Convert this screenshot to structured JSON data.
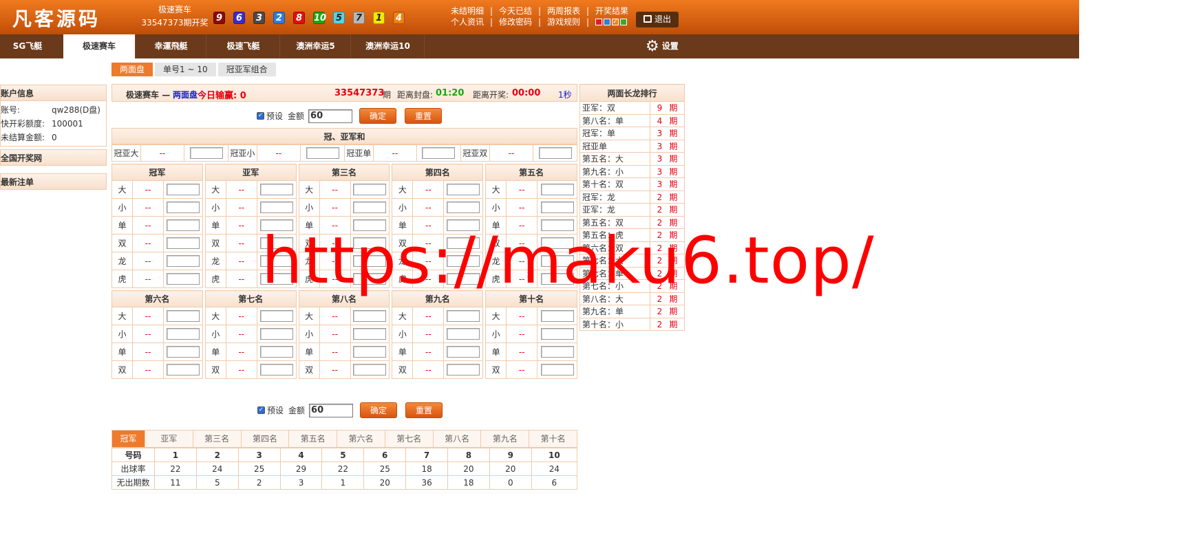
{
  "header": {
    "logo": "凡客源码",
    "game_name": "极速赛车",
    "period_text": "33547373期开奖",
    "balls": [
      {
        "n": "9",
        "color": "#8b0a0a"
      },
      {
        "n": "6",
        "color": "#3a2bd6"
      },
      {
        "n": "3",
        "color": "#4a4a4a"
      },
      {
        "n": "2",
        "color": "#2a7de0"
      },
      {
        "n": "8",
        "color": "#e01010"
      },
      {
        "n": "10",
        "color": "#17a812"
      },
      {
        "n": "5",
        "color": "#4fd5e5"
      },
      {
        "n": "7",
        "color": "#b7b7b7"
      },
      {
        "n": "1",
        "color": "#f5e800"
      },
      {
        "n": "4",
        "color": "#f07e10"
      }
    ],
    "links_row1": [
      "未结明细",
      "今天已结",
      "两周报表",
      "开奖结果"
    ],
    "links_row2": [
      "个人资讯",
      "修改密码",
      "游戏规则"
    ],
    "sep": "|",
    "swatches": [
      "#e02020",
      "#3a7ad8",
      "#f08020",
      "#3aa82a"
    ],
    "logout": "退出"
  },
  "nav": {
    "tabs": [
      "SG飞艇",
      "极速赛车",
      "幸運飛艇",
      "极速飞艇",
      "澳洲幸运5",
      "澳洲幸运10"
    ],
    "active": "极速赛车",
    "settings": "设置"
  },
  "subtabs": [
    "两面盘",
    "单号1 ~ 10",
    "冠亚军组合"
  ],
  "sidebar": {
    "account_title": "账户信息",
    "account_rows": [
      {
        "k": "账号:",
        "v": "qw288(D盘)"
      },
      {
        "k": "快开彩额度:",
        "v": "100001"
      },
      {
        "k": "未结算金额:",
        "v": "0"
      }
    ],
    "section2": "全国开奖网",
    "section3": "最新注单"
  },
  "status": {
    "game": "极速赛车",
    "dash": "—",
    "mode": "两面盘",
    "today_label": "今日输赢:",
    "today_value": "0",
    "period": "33547373",
    "period_suffix": "期",
    "close_label": "距离封盘:",
    "close_time": "01:20",
    "draw_label": "距离开奖:",
    "draw_time": "00:00",
    "refresh": "1秒"
  },
  "preset": {
    "label": "预设",
    "amount_label": "金额",
    "amount": "60",
    "confirm": "确定",
    "reset": "重置"
  },
  "guanya": {
    "title": "冠、亚军和",
    "items": [
      {
        "name": "冠亚大",
        "odds": "--"
      },
      {
        "name": "冠亚小",
        "odds": "--"
      },
      {
        "name": "冠亚单",
        "odds": "--"
      },
      {
        "name": "冠亚双",
        "odds": "--"
      }
    ]
  },
  "ranks_top": [
    {
      "title": "冠军",
      "rows": [
        "大",
        "小",
        "单",
        "双",
        "龙",
        "虎"
      ]
    },
    {
      "title": "亚军",
      "rows": [
        "大",
        "小",
        "单",
        "双",
        "龙",
        "虎"
      ]
    },
    {
      "title": "第三名",
      "rows": [
        "大",
        "小",
        "单",
        "双",
        "龙",
        "虎"
      ]
    },
    {
      "title": "第四名",
      "rows": [
        "大",
        "小",
        "单",
        "双",
        "龙",
        "虎"
      ]
    },
    {
      "title": "第五名",
      "rows": [
        "大",
        "小",
        "单",
        "双",
        "龙",
        "虎"
      ]
    }
  ],
  "ranks_bottom": [
    {
      "title": "第六名",
      "rows": [
        "大",
        "小",
        "单",
        "双"
      ]
    },
    {
      "title": "第七名",
      "rows": [
        "大",
        "小",
        "单",
        "双"
      ]
    },
    {
      "title": "第八名",
      "rows": [
        "大",
        "小",
        "单",
        "双"
      ]
    },
    {
      "title": "第九名",
      "rows": [
        "大",
        "小",
        "单",
        "双"
      ]
    },
    {
      "title": "第十名",
      "rows": [
        "大",
        "小",
        "单",
        "双"
      ]
    }
  ],
  "odds_placeholder": "--",
  "stats": {
    "tabs": [
      "冠军",
      "亚军",
      "第三名",
      "第四名",
      "第五名",
      "第六名",
      "第七名",
      "第八名",
      "第九名",
      "第十名"
    ],
    "active": "冠军",
    "header": [
      "号码",
      "1",
      "2",
      "3",
      "4",
      "5",
      "6",
      "7",
      "8",
      "9",
      "10"
    ],
    "rows": [
      [
        "出球率",
        "22",
        "24",
        "25",
        "29",
        "22",
        "25",
        "18",
        "20",
        "20",
        "24"
      ],
      [
        "无出期数",
        "11",
        "5",
        "2",
        "3",
        "1",
        "20",
        "36",
        "18",
        "0",
        "6"
      ]
    ]
  },
  "longdragon": {
    "title": "两面长龙排行",
    "unit": "期",
    "items": [
      {
        "k": "亚军：双",
        "v": "9"
      },
      {
        "k": "第八名：单",
        "v": "4"
      },
      {
        "k": "冠军：单",
        "v": "3"
      },
      {
        "k": "冠亚单",
        "v": "3"
      },
      {
        "k": "第五名：大",
        "v": "3"
      },
      {
        "k": "第九名：小",
        "v": "3"
      },
      {
        "k": "第十名：双",
        "v": "3"
      },
      {
        "k": "冠军：龙",
        "v": "2"
      },
      {
        "k": "亚军：龙",
        "v": "2"
      },
      {
        "k": "第五名：双",
        "v": "2"
      },
      {
        "k": "第五名：虎",
        "v": "2"
      },
      {
        "k": "第六名：双",
        "v": "2"
      },
      {
        "k": "第七名：大",
        "v": "2"
      },
      {
        "k": "第七名：单",
        "v": "2"
      },
      {
        "k": "第七名：小",
        "v": "2"
      },
      {
        "k": "第八名：大",
        "v": "2"
      },
      {
        "k": "第九名：单",
        "v": "2"
      },
      {
        "k": "第十名：小",
        "v": "2"
      }
    ]
  },
  "watermark": "https://maku6.top/"
}
